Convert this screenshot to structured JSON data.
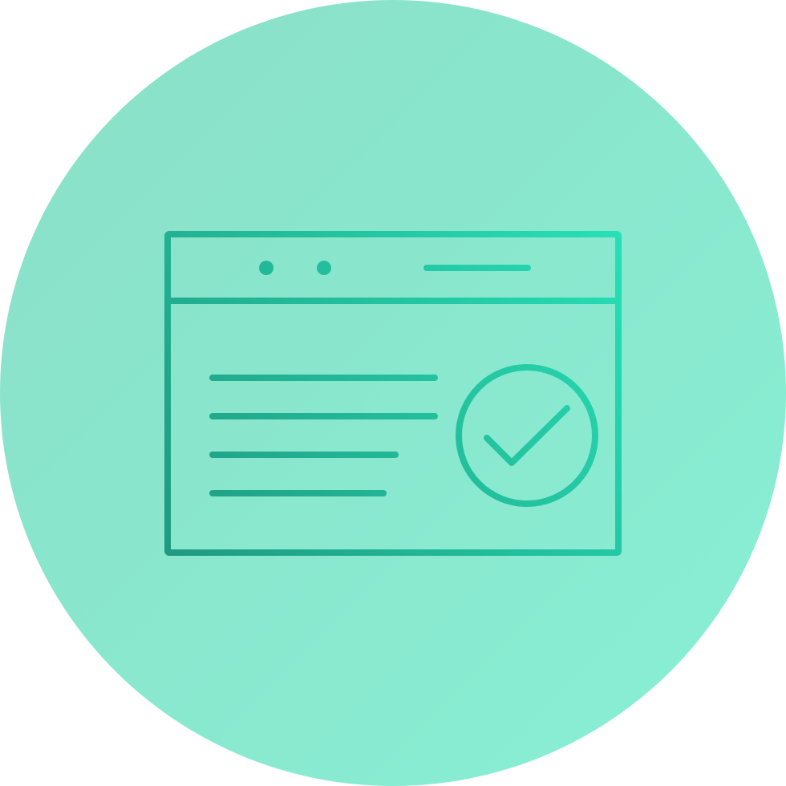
{
  "icon": {
    "name": "browser-window-verified-icon",
    "background_color_start": "#8adfc7",
    "background_color_end": "#88f0d5",
    "stroke_color_start": "#1f9a80",
    "stroke_color_end": "#27e0b6"
  }
}
